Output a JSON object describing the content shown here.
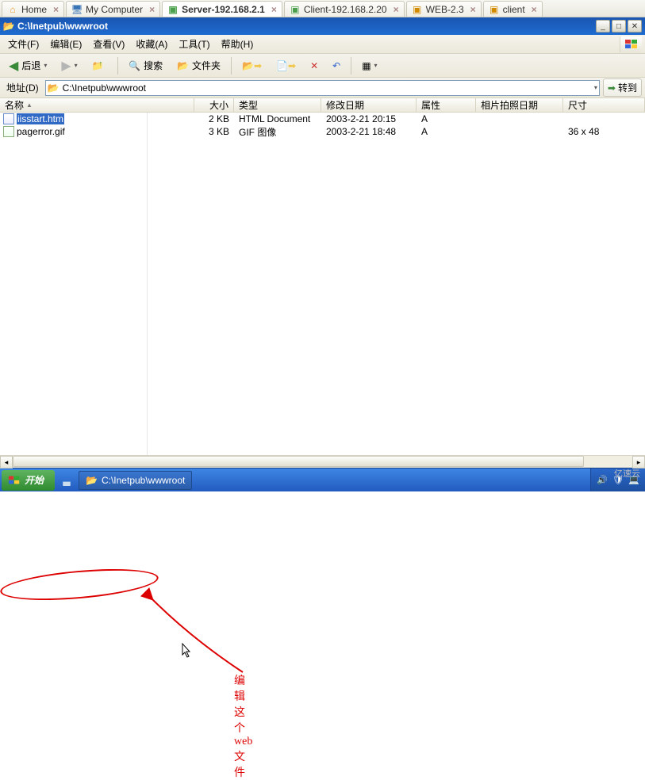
{
  "tabs": [
    {
      "label": "Home",
      "active": false
    },
    {
      "label": "My Computer",
      "active": false
    },
    {
      "label": "Server-192.168.2.1",
      "active": true
    },
    {
      "label": "Client-192.168.2.20",
      "active": false
    },
    {
      "label": "WEB-2.3",
      "active": false
    },
    {
      "label": "client",
      "active": false
    }
  ],
  "window": {
    "title": "C:\\Inetpub\\wwwroot"
  },
  "menu": {
    "file": "文件(F)",
    "edit": "编辑(E)",
    "view": "查看(V)",
    "favorites": "收藏(A)",
    "tools": "工具(T)",
    "help": "帮助(H)"
  },
  "toolbar": {
    "back": "后退",
    "search": "搜索",
    "folders": "文件夹"
  },
  "address": {
    "label": "地址(D)",
    "value": "C:\\Inetpub\\wwwroot",
    "go": "转到"
  },
  "columns": {
    "name": "名称",
    "size": "大小",
    "type": "类型",
    "modified": "修改日期",
    "attrs": "属性",
    "photodate": "相片拍照日期",
    "dim": "尺寸"
  },
  "files": [
    {
      "name": "iisstart.htm",
      "size": "2 KB",
      "type": "HTML Document",
      "modified": "2003-2-21 20:15",
      "attrs": "A",
      "photodate": "",
      "dim": "",
      "selected": true,
      "icon": "htm"
    },
    {
      "name": "pagerror.gif",
      "size": "3 KB",
      "type": "GIF 图像",
      "modified": "2003-2-21 18:48",
      "attrs": "A",
      "photodate": "",
      "dim": "36 x 48",
      "selected": false,
      "icon": "gif"
    }
  ],
  "annotation": {
    "text": "编辑这个web文件"
  },
  "taskbar": {
    "start": "开始",
    "item": "C:\\Inetpub\\wwwroot"
  },
  "brand": "亿速云"
}
